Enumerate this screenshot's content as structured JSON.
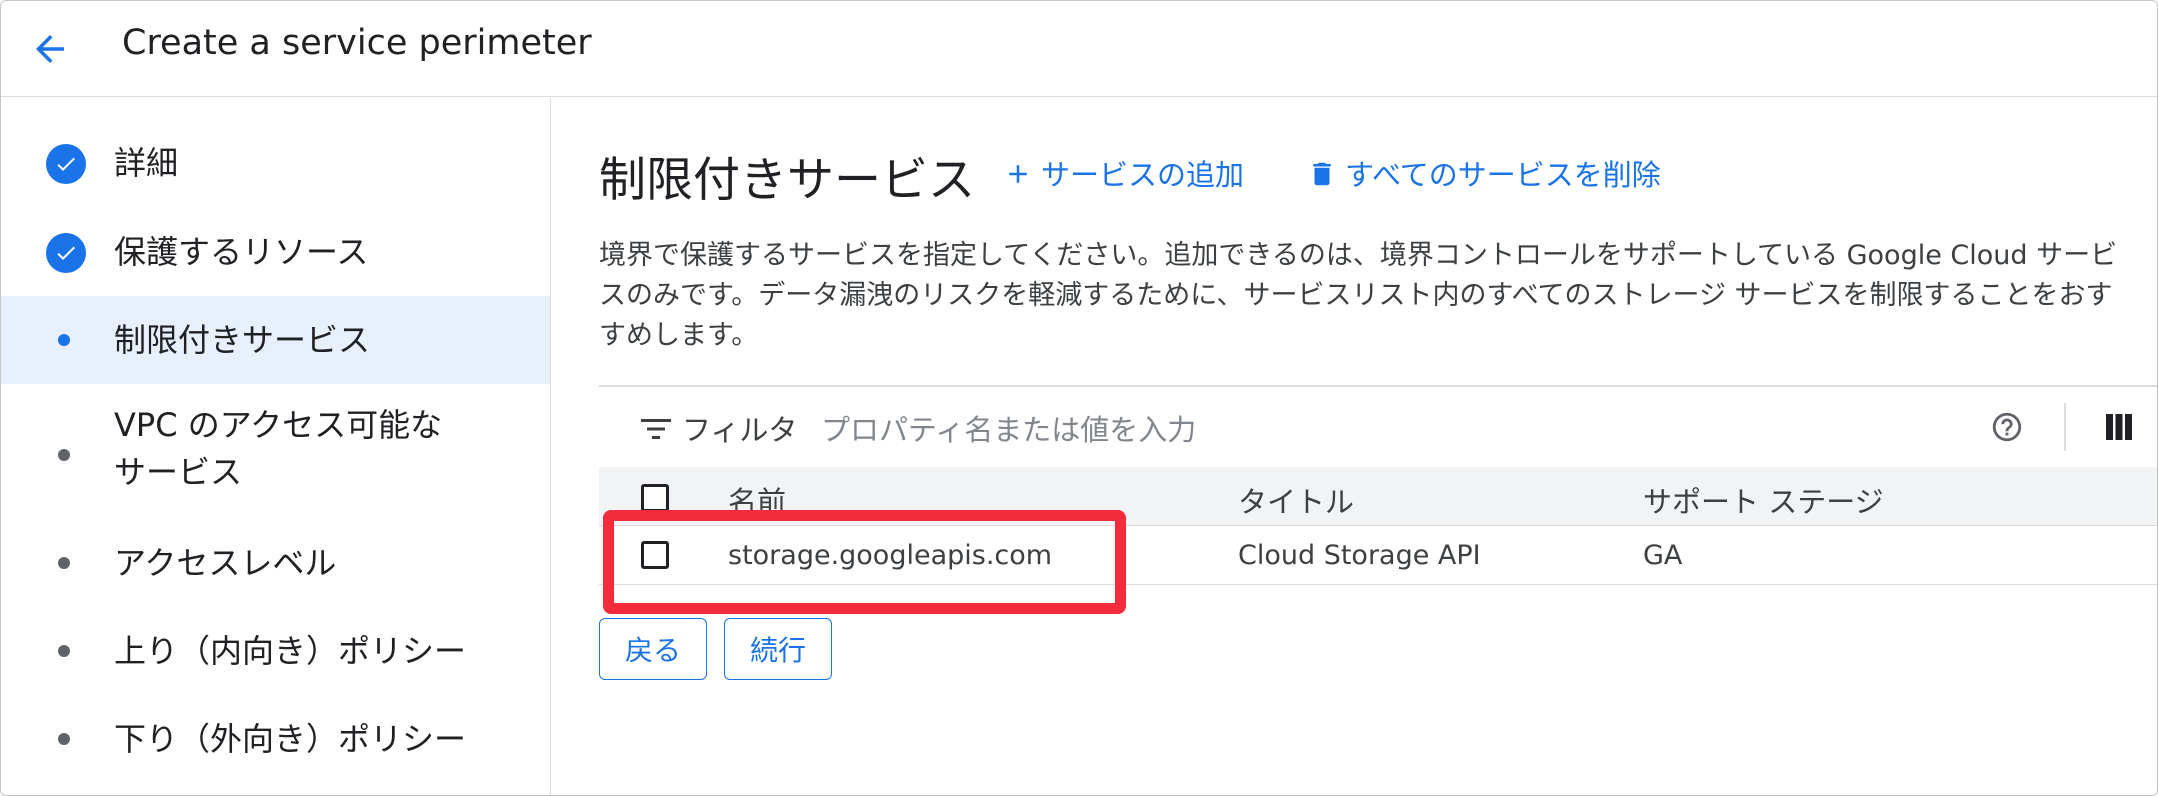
{
  "header": {
    "title": "Create a service perimeter"
  },
  "sidebar": {
    "steps": [
      {
        "label": "詳細",
        "state": "done"
      },
      {
        "label": "保護するリソース",
        "state": "done"
      },
      {
        "label": "制限付きサービス",
        "state": "active"
      },
      {
        "label": "VPC のアクセス可能な",
        "label2": "サービス",
        "state": "pending"
      },
      {
        "label": "アクセスレベル",
        "state": "pending"
      },
      {
        "label": "上り（内向き）ポリシー",
        "state": "pending"
      },
      {
        "label": "下り（外向き）ポリシー",
        "state": "pending"
      }
    ]
  },
  "main": {
    "title": "制限付きサービス",
    "add_service": "サービスの追加",
    "remove_all": "すべてのサービスを削除",
    "description": [
      "境界で保護するサービスを指定してください。追加できるのは、境界コントロールをサポートしている Google Cloud サービ",
      "スのみです。データ漏洩のリスクを軽減するために、サービスリスト内のすべてのストレージ サービスを制限することをおす",
      "すめします。"
    ],
    "filter": {
      "label": "フィルタ",
      "placeholder": "プロパティ名または値を入力"
    },
    "table": {
      "columns": [
        "名前",
        "タイトル",
        "サポート ステージ"
      ],
      "rows": [
        {
          "name": "storage.googleapis.com",
          "title": "Cloud Storage API",
          "stage": "GA"
        }
      ]
    },
    "buttons": {
      "back": "戻る",
      "continue": "続行"
    }
  },
  "colors": {
    "accent": "#1a73e8",
    "highlight": "#f32c3c",
    "active_bg": "#e8f0fe"
  }
}
